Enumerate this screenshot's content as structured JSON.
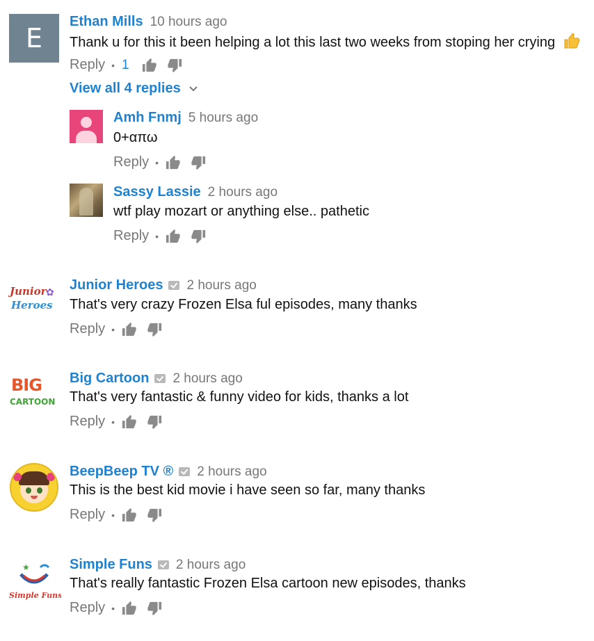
{
  "comments": [
    {
      "author": "Ethan Mills",
      "time": "10 hours ago",
      "text": "Thank u for this it been helping a lot this last two weeks from stoping her crying",
      "reply_label": "Reply",
      "like_count": "1",
      "avatar_letter": "E",
      "avatar_color": "#6f8391"
    },
    {
      "author": "Amh Fnmj",
      "time": "5 hours ago",
      "text": "0+απω",
      "reply_label": "Reply",
      "avatar_color": "#e8457a"
    },
    {
      "author": "Sassy Lassie",
      "time": "2 hours ago",
      "text": "wtf play mozart or anything else.. pathetic",
      "reply_label": "Reply"
    },
    {
      "author": "Junior Heroes",
      "time": "2 hours ago",
      "text": "That's very crazy Frozen Elsa ful episodes, many thanks",
      "reply_label": "Reply",
      "avatar_logo_line1": "Junior",
      "avatar_logo_line2": "Heroes"
    },
    {
      "author": "Big Cartoon",
      "time": "2 hours ago",
      "text": "That's very fantastic & funny video for kids, thanks a lot",
      "reply_label": "Reply",
      "avatar_logo_line1": "BIG",
      "avatar_logo_line2": "CARTOON"
    },
    {
      "author": "BeepBeep TV ®",
      "time": "2 hours ago",
      "text": "This is the best kid movie i have seen so far, many thanks",
      "reply_label": "Reply"
    },
    {
      "author": "Simple Funs",
      "time": "2 hours ago",
      "text": "That's really fantastic Frozen Elsa cartoon new episodes, thanks",
      "reply_label": "Reply",
      "avatar_logo_text": "Simple Funs"
    }
  ],
  "view_replies_label": "View all 4 replies",
  "colors": {
    "author_link": "#1f82d0",
    "muted": "#777777",
    "icon": "#8a8a8a"
  },
  "icons": [
    "thumbs-up-icon",
    "thumbs-down-icon",
    "verified-badge-icon",
    "chevron-down-icon",
    "thumbs-up-emoji"
  ]
}
